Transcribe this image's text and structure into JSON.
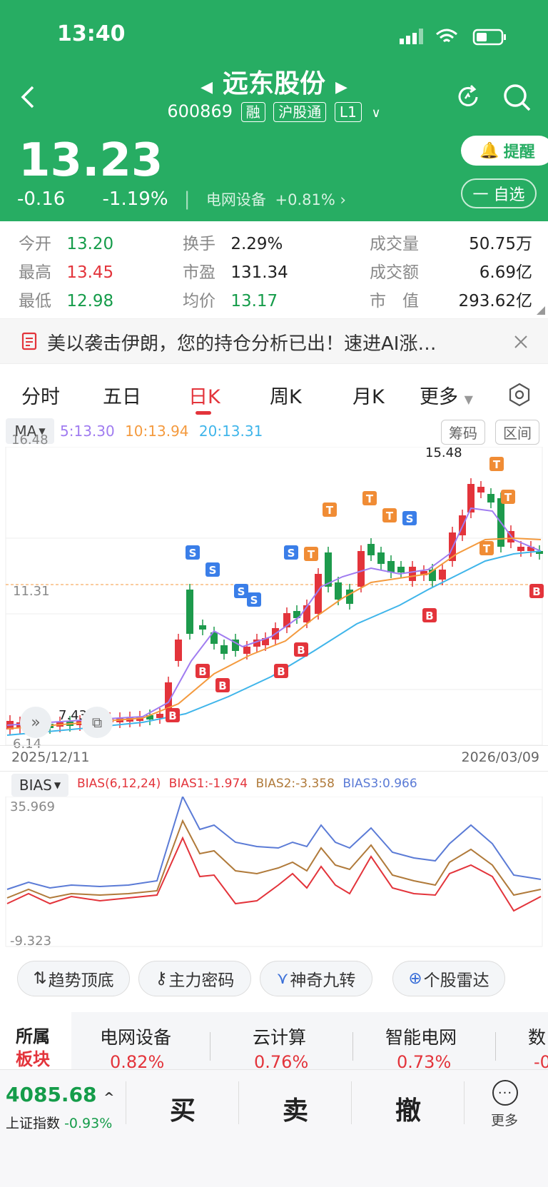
{
  "status": {
    "time": "13:40"
  },
  "header": {
    "stock_name": "远东股份",
    "stock_code": "600869",
    "tags": [
      "融",
      "沪股通",
      "L1"
    ],
    "price": "13.23",
    "change": "-0.16",
    "change_pct": "-1.19%",
    "sector_label": "电网设备",
    "sector_change": "+0.81%",
    "alert_label": "提醒",
    "fav_label": "一 自选"
  },
  "stats": {
    "open_label": "今开",
    "open": "13.20",
    "high_label": "最高",
    "high": "13.45",
    "low_label": "最低",
    "low": "12.98",
    "turnover_label": "换手",
    "turnover": "2.29%",
    "pe_label": "市盈",
    "pe": "131.34",
    "avg_label": "均价",
    "avg": "13.17",
    "volume_label": "成交量",
    "volume": "50.75万",
    "amount_label": "成交额",
    "amount": "6.69亿",
    "mktcap_label": "市　值",
    "mktcap": "293.62亿"
  },
  "news": {
    "text": "美以袭击伊朗，您的持仓分析已出！速进AI涨…"
  },
  "tabs": [
    "分时",
    "五日",
    "日K",
    "周K",
    "月K",
    "更多"
  ],
  "chart": {
    "ma_label": "MA",
    "ma5": "5:13.30",
    "ma10": "10:13.94",
    "ma20": "20:13.31",
    "btn_chip": "筹码",
    "btn_range": "区间",
    "y_top": "16.48",
    "y_mid": "11.31",
    "y_bot": "6.14",
    "high_mark": "15.48",
    "low_mark": "7.43",
    "date_start": "2025/12/11",
    "date_end": "2026/03/09",
    "colors": {
      "up": "#e3343b",
      "down": "#1d9a4c",
      "ma5": "#a07cf0",
      "ma10": "#f49a3e",
      "ma20": "#3fb5ea"
    }
  },
  "bias": {
    "label": "BIAS",
    "params": "BIAS(6,12,24)",
    "b1": "BIAS1:-1.974",
    "b2": "BIAS2:-3.358",
    "b3": "BIAS3:0.966",
    "y_top": "35.969",
    "y_bot": "-9.323"
  },
  "tools": [
    "趋势顶底",
    "主力密码",
    "神奇九转",
    "个股雷达"
  ],
  "sectors": {
    "title1": "所属",
    "title2": "板块",
    "items": [
      {
        "name": "电网设备",
        "pct": "0.82%"
      },
      {
        "name": "云计算",
        "pct": "0.76%"
      },
      {
        "name": "智能电网",
        "pct": "0.73%"
      },
      {
        "name": "数",
        "pct": "-0"
      }
    ]
  },
  "footer": {
    "index_value": "4085.68",
    "index_name": "上证指数",
    "index_pct": "-0.93%",
    "buy": "买",
    "sell": "卖",
    "cancel": "撤",
    "more": "更多"
  }
}
